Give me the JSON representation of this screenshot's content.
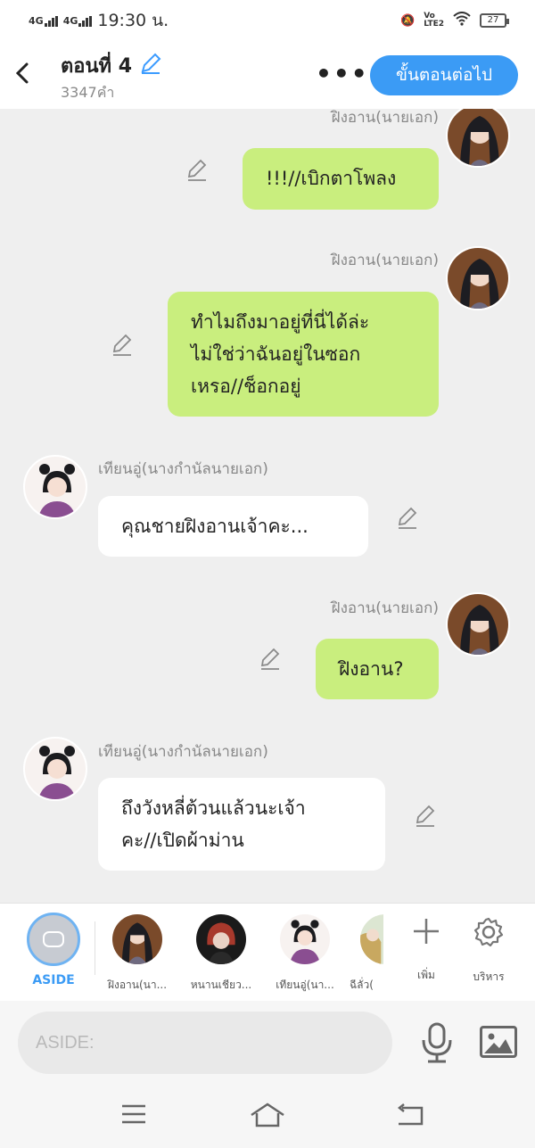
{
  "status_bar": {
    "network_left": "4G",
    "network_right": "4G",
    "time": "19:30 น.",
    "battery": "27"
  },
  "header": {
    "title": "ตอนที่ 4",
    "word_count": "3347คำ",
    "next_button": "ขั้นตอนต่อไป"
  },
  "messages": [
    {
      "side": "right",
      "name": "ฝิงอาน(นายเอก)",
      "text": "!!!//เบิกตาโพลง",
      "avatar": "man-avatar"
    },
    {
      "side": "right",
      "name": "ฝิงอาน(นายเอก)",
      "text": "ทำไมถึงมาอยู่ที่นี่ได้ล่ะ\nไม่ใช่ว่าฉันอยู่ในซอก\nเหรอ//ช็อกอยู่",
      "avatar": "man-avatar"
    },
    {
      "side": "left",
      "name": "เทียนอู่(นางกำนัลนายเอก)",
      "text": "คุณชายฝิงอานเจ้าคะ...",
      "avatar": "girl-avatar"
    },
    {
      "side": "right",
      "name": "ฝิงอาน(นายเอก)",
      "text": "ฝิงอาน?",
      "avatar": "man-avatar"
    },
    {
      "side": "left",
      "name": "เทียนอู่(นางกำนัลนายเอก)",
      "text": "ถึงวังหลี่ต้วนแล้วนะเจ้า\nคะ//เปิดผ้าม่าน",
      "avatar": "girl-avatar"
    }
  ],
  "character_bar": {
    "aside_label": "ASIDE",
    "characters": [
      {
        "label": "ฝิงอาน(นา...",
        "avatar": "man-avatar"
      },
      {
        "label": "หนานเชียว...",
        "avatar": "red-hair-avatar"
      },
      {
        "label": "เทียนอู่(นา...",
        "avatar": "girl-avatar"
      },
      {
        "label": "ฉีลั่ว(",
        "avatar": "partial-avatar"
      }
    ],
    "add_label": "เพิ่ม",
    "manage_label": "บริหาร"
  },
  "input": {
    "placeholder": "ASIDE:"
  },
  "colors": {
    "accent": "#3b9bf5",
    "bubble_right": "#c9ee7e",
    "bubble_left": "#ffffff",
    "background": "#efefef"
  }
}
